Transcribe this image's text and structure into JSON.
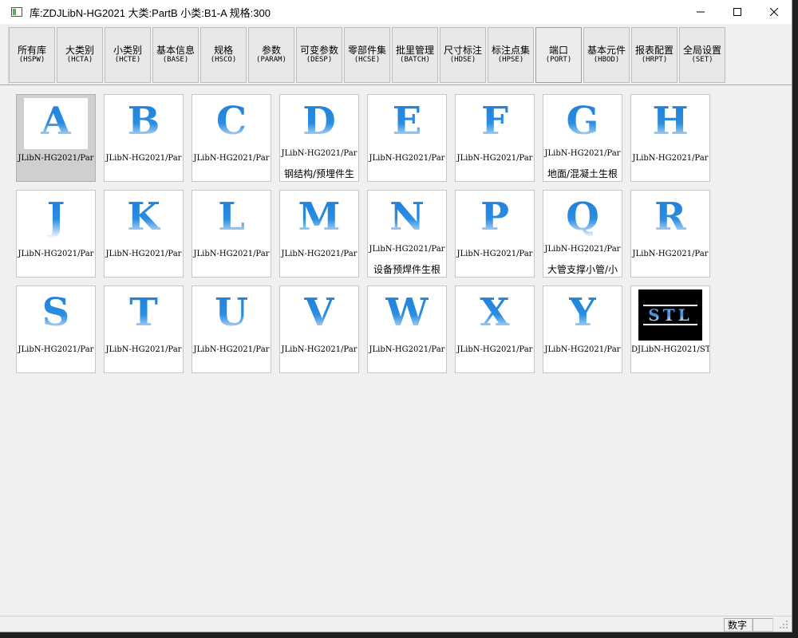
{
  "window": {
    "title": "库:ZDJLibN-HG2021  大类:PartB  小类:B1-A  规格:300"
  },
  "toolbar": {
    "buttons": [
      {
        "label": "所有库",
        "code": "(HSPW)"
      },
      {
        "label": "大类别",
        "code": "(HCTA)"
      },
      {
        "label": "小类别",
        "code": "(HCTE)"
      },
      {
        "label": "基本信息",
        "code": "(BASE)"
      },
      {
        "label": "规格",
        "code": "(HSCO)"
      },
      {
        "label": "参数",
        "code": "(PARAM)"
      },
      {
        "label": "可变参数",
        "code": "(DESP)"
      },
      {
        "label": "零部件集",
        "code": "(HCSE)"
      },
      {
        "label": "批里管理",
        "code": "(BATCH)"
      },
      {
        "label": "尺寸标注",
        "code": "(HDSE)"
      },
      {
        "label": "标注点集",
        "code": "(HPSE)"
      },
      {
        "label": "端口",
        "code": "(PORT)"
      },
      {
        "label": "基本元件",
        "code": "(HBOD)"
      },
      {
        "label": "报表配置",
        "code": "(HRPT)"
      },
      {
        "label": "全局设置",
        "code": "(SET)"
      }
    ]
  },
  "tiles": [
    {
      "letter": "A",
      "caption": "JLibN-HG2021/Par",
      "caption2": ""
    },
    {
      "letter": "B",
      "caption": "JLibN-HG2021/Par",
      "caption2": ""
    },
    {
      "letter": "C",
      "caption": "JLibN-HG2021/Par",
      "caption2": ""
    },
    {
      "letter": "D",
      "caption": "JLibN-HG2021/Par",
      "caption2": "钢结构/预埋件生"
    },
    {
      "letter": "E",
      "caption": "JLibN-HG2021/Par",
      "caption2": ""
    },
    {
      "letter": "F",
      "caption": "JLibN-HG2021/Par",
      "caption2": ""
    },
    {
      "letter": "G",
      "caption": "JLibN-HG2021/Par",
      "caption2": "地面/混凝土生根"
    },
    {
      "letter": "H",
      "caption": "JLibN-HG2021/Par",
      "caption2": ""
    },
    {
      "letter": "J",
      "caption": "JLibN-HG2021/Par",
      "caption2": ""
    },
    {
      "letter": "K",
      "caption": "JLibN-HG2021/Par",
      "caption2": ""
    },
    {
      "letter": "L",
      "caption": "JLibN-HG2021/Par",
      "caption2": ""
    },
    {
      "letter": "M",
      "caption": "JLibN-HG2021/Par",
      "caption2": ""
    },
    {
      "letter": "N",
      "caption": "JLibN-HG2021/Par",
      "caption2": "设备预焊件生根"
    },
    {
      "letter": "P",
      "caption": "JLibN-HG2021/Par",
      "caption2": ""
    },
    {
      "letter": "Q",
      "caption": "JLibN-HG2021/Par",
      "caption2": "大管支撑小管/小"
    },
    {
      "letter": "R",
      "caption": "JLibN-HG2021/Par",
      "caption2": ""
    },
    {
      "letter": "S",
      "caption": "JLibN-HG2021/Par",
      "caption2": ""
    },
    {
      "letter": "T",
      "caption": "JLibN-HG2021/Par",
      "caption2": ""
    },
    {
      "letter": "U",
      "caption": "JLibN-HG2021/Par",
      "caption2": ""
    },
    {
      "letter": "V",
      "caption": "JLibN-HG2021/Par",
      "caption2": ""
    },
    {
      "letter": "W",
      "caption": "JLibN-HG2021/Par",
      "caption2": ""
    },
    {
      "letter": "X",
      "caption": "JLibN-HG2021/Par",
      "caption2": ""
    },
    {
      "letter": "Y",
      "caption": "JLibN-HG2021/Par",
      "caption2": ""
    },
    {
      "letter": "STL",
      "caption": "DJLibN-HG2021/STI",
      "caption2": ""
    }
  ],
  "status": {
    "mode": "数字"
  }
}
